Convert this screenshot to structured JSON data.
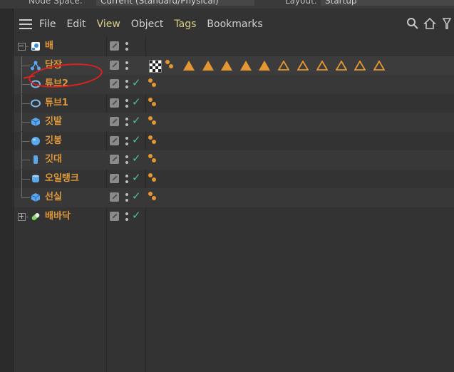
{
  "topbar": {
    "mode_label": "Node Space:",
    "mode_value": "Current (Standard/Physical)",
    "layout_label": "Layout:",
    "layout_value": "Startup"
  },
  "menu": {
    "items": [
      "File",
      "Edit",
      "View",
      "Object",
      "Tags",
      "Bookmarks"
    ],
    "highlighted": [
      "View",
      "Tags"
    ]
  },
  "icons": {
    "search": "search-icon",
    "home": "home-icon",
    "filter": "filter-icon"
  },
  "colors": {
    "accent_orange": "#e39632",
    "object_name": "#e0983a",
    "check_green": "#4fbf8a",
    "annotation_red": "#e0201e"
  },
  "objects": [
    {
      "name": "배",
      "icon": "null-object-icon",
      "indent": 0,
      "expand": "collapse",
      "check": false,
      "tags": "none"
    },
    {
      "name": "담장",
      "icon": "cloner-icon",
      "indent": 1,
      "check": false,
      "tags": "texture-row",
      "circled": true
    },
    {
      "name": "튜브2",
      "icon": "tube-icon",
      "indent": 1,
      "check": true,
      "tags": "material"
    },
    {
      "name": "튜브1",
      "icon": "tube-icon",
      "indent": 1,
      "check": true,
      "tags": "material"
    },
    {
      "name": "깃발",
      "icon": "cube-icon",
      "indent": 1,
      "check": true,
      "tags": "material"
    },
    {
      "name": "깃봉",
      "icon": "sphere-icon",
      "indent": 1,
      "check": true,
      "tags": "material"
    },
    {
      "name": "깃대",
      "icon": "cylinder-icon",
      "indent": 1,
      "check": true,
      "tags": "material"
    },
    {
      "name": "오일탱크",
      "icon": "oil-tank-icon",
      "indent": 1,
      "check": true,
      "tags": "material"
    },
    {
      "name": "선실",
      "icon": "cube-icon",
      "indent": 1,
      "check": true,
      "tags": "material"
    },
    {
      "name": "배바닥",
      "icon": "capsule-icon",
      "indent": 0,
      "expand": "expand",
      "check": true,
      "tags": "none"
    }
  ],
  "tags_row_1": {
    "filled_triangles": 5,
    "outline_triangles": 6
  }
}
